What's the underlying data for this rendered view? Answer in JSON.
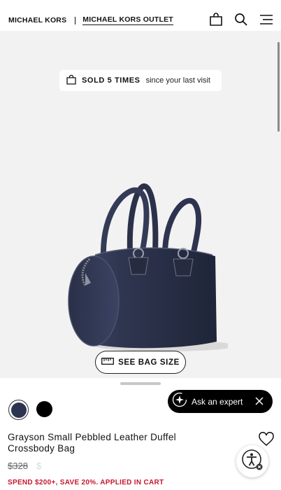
{
  "header": {
    "brand": "MICHAEL KORS",
    "outlet": "MICHAEL KORS OUTLET",
    "icons": [
      "shopping-bag-icon",
      "search-icon",
      "menu-icon"
    ]
  },
  "hero": {
    "sold_prefix": "SOLD 5 TIMES",
    "sold_suffix": "since your last visit",
    "see_size_label": "SEE BAG SIZE"
  },
  "swatches": [
    {
      "name": "navy",
      "color": "#2d3450",
      "selected": true
    },
    {
      "name": "black",
      "color": "#000000",
      "selected": false
    }
  ],
  "expert": {
    "label": "Ask an expert"
  },
  "product": {
    "title": "Grayson Small Pebbled Leather Duffel Crossbody Bag",
    "original_price": "$328",
    "sale_price": "$",
    "promo": "SPEND $200+, SAVE 20%. APPLIED IN CART"
  },
  "colors": {
    "accent_red": "#c7162b",
    "bag_navy": "#2d3450"
  }
}
